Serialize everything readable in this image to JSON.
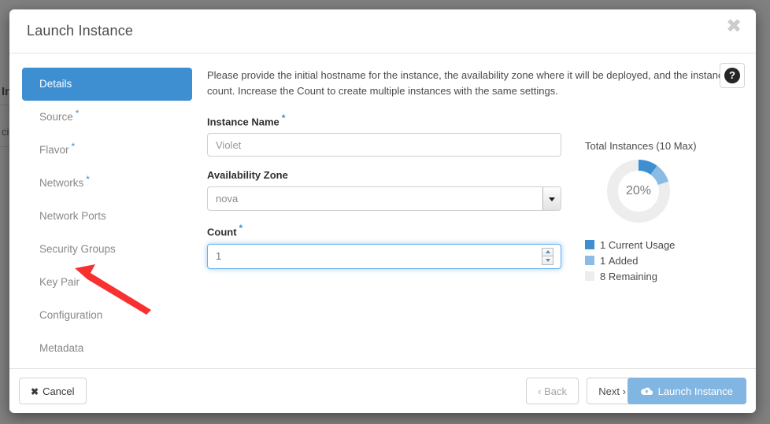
{
  "background_page": {
    "heading": "In",
    "text": "ci"
  },
  "modal": {
    "title": "Launch Instance",
    "close_icon": "close-icon",
    "help_icon": "question-mark-icon",
    "help_glyph": "?",
    "close_glyph": "✖"
  },
  "wizard_nav": {
    "items": [
      {
        "label": "Details",
        "required": false,
        "active": true
      },
      {
        "label": "Source",
        "required": true,
        "active": false
      },
      {
        "label": "Flavor",
        "required": true,
        "active": false
      },
      {
        "label": "Networks",
        "required": true,
        "active": false
      },
      {
        "label": "Network Ports",
        "required": false,
        "active": false
      },
      {
        "label": "Security Groups",
        "required": false,
        "active": false
      },
      {
        "label": "Key Pair",
        "required": false,
        "active": false
      },
      {
        "label": "Configuration",
        "required": false,
        "active": false
      },
      {
        "label": "Metadata",
        "required": false,
        "active": false
      }
    ],
    "required_marker": "*"
  },
  "form": {
    "intro": "Please provide the initial hostname for the instance, the availability zone where it will be deployed, and the instance count. Increase the Count to create multiple instances with the same settings.",
    "instance_name": {
      "label": "Instance Name",
      "required_marker": "*",
      "value": "Violet",
      "placeholder": "Violet"
    },
    "availability_zone": {
      "label": "Availability Zone",
      "value": "nova",
      "options": [
        "nova"
      ]
    },
    "count": {
      "label": "Count",
      "required_marker": "*",
      "value": "1",
      "placeholder": "1"
    }
  },
  "chart_data": {
    "type": "pie",
    "title": "Total Instances (10 Max)",
    "center_label": "20%",
    "max": 10,
    "categories": [
      "Current Usage",
      "Added",
      "Remaining"
    ],
    "values": [
      1,
      1,
      8
    ],
    "colors": [
      "#3d8fd1",
      "#8bbce5",
      "#ededed"
    ],
    "legend_position": "bottom-left",
    "legend": [
      {
        "value": "1",
        "label": "Current Usage",
        "color": "#3d8fd1"
      },
      {
        "value": "1",
        "label": "Added",
        "color": "#8bbce5"
      },
      {
        "value": "8",
        "label": "Remaining",
        "color": "#ededed"
      }
    ]
  },
  "footer": {
    "cancel_label": "Cancel",
    "cancel_icon": "x-icon",
    "back_label": "Back",
    "back_icon": "chevron-left-icon",
    "next_label": "Next",
    "next_icon": "chevron-right-icon",
    "launch_label": "Launch Instance",
    "launch_icon": "cloud-upload-icon",
    "back_glyph": "‹",
    "next_glyph": "›",
    "cancel_glyph": "✖"
  },
  "annotation": {
    "arrow_color": "#f83030",
    "points_to": "Key Pair"
  }
}
